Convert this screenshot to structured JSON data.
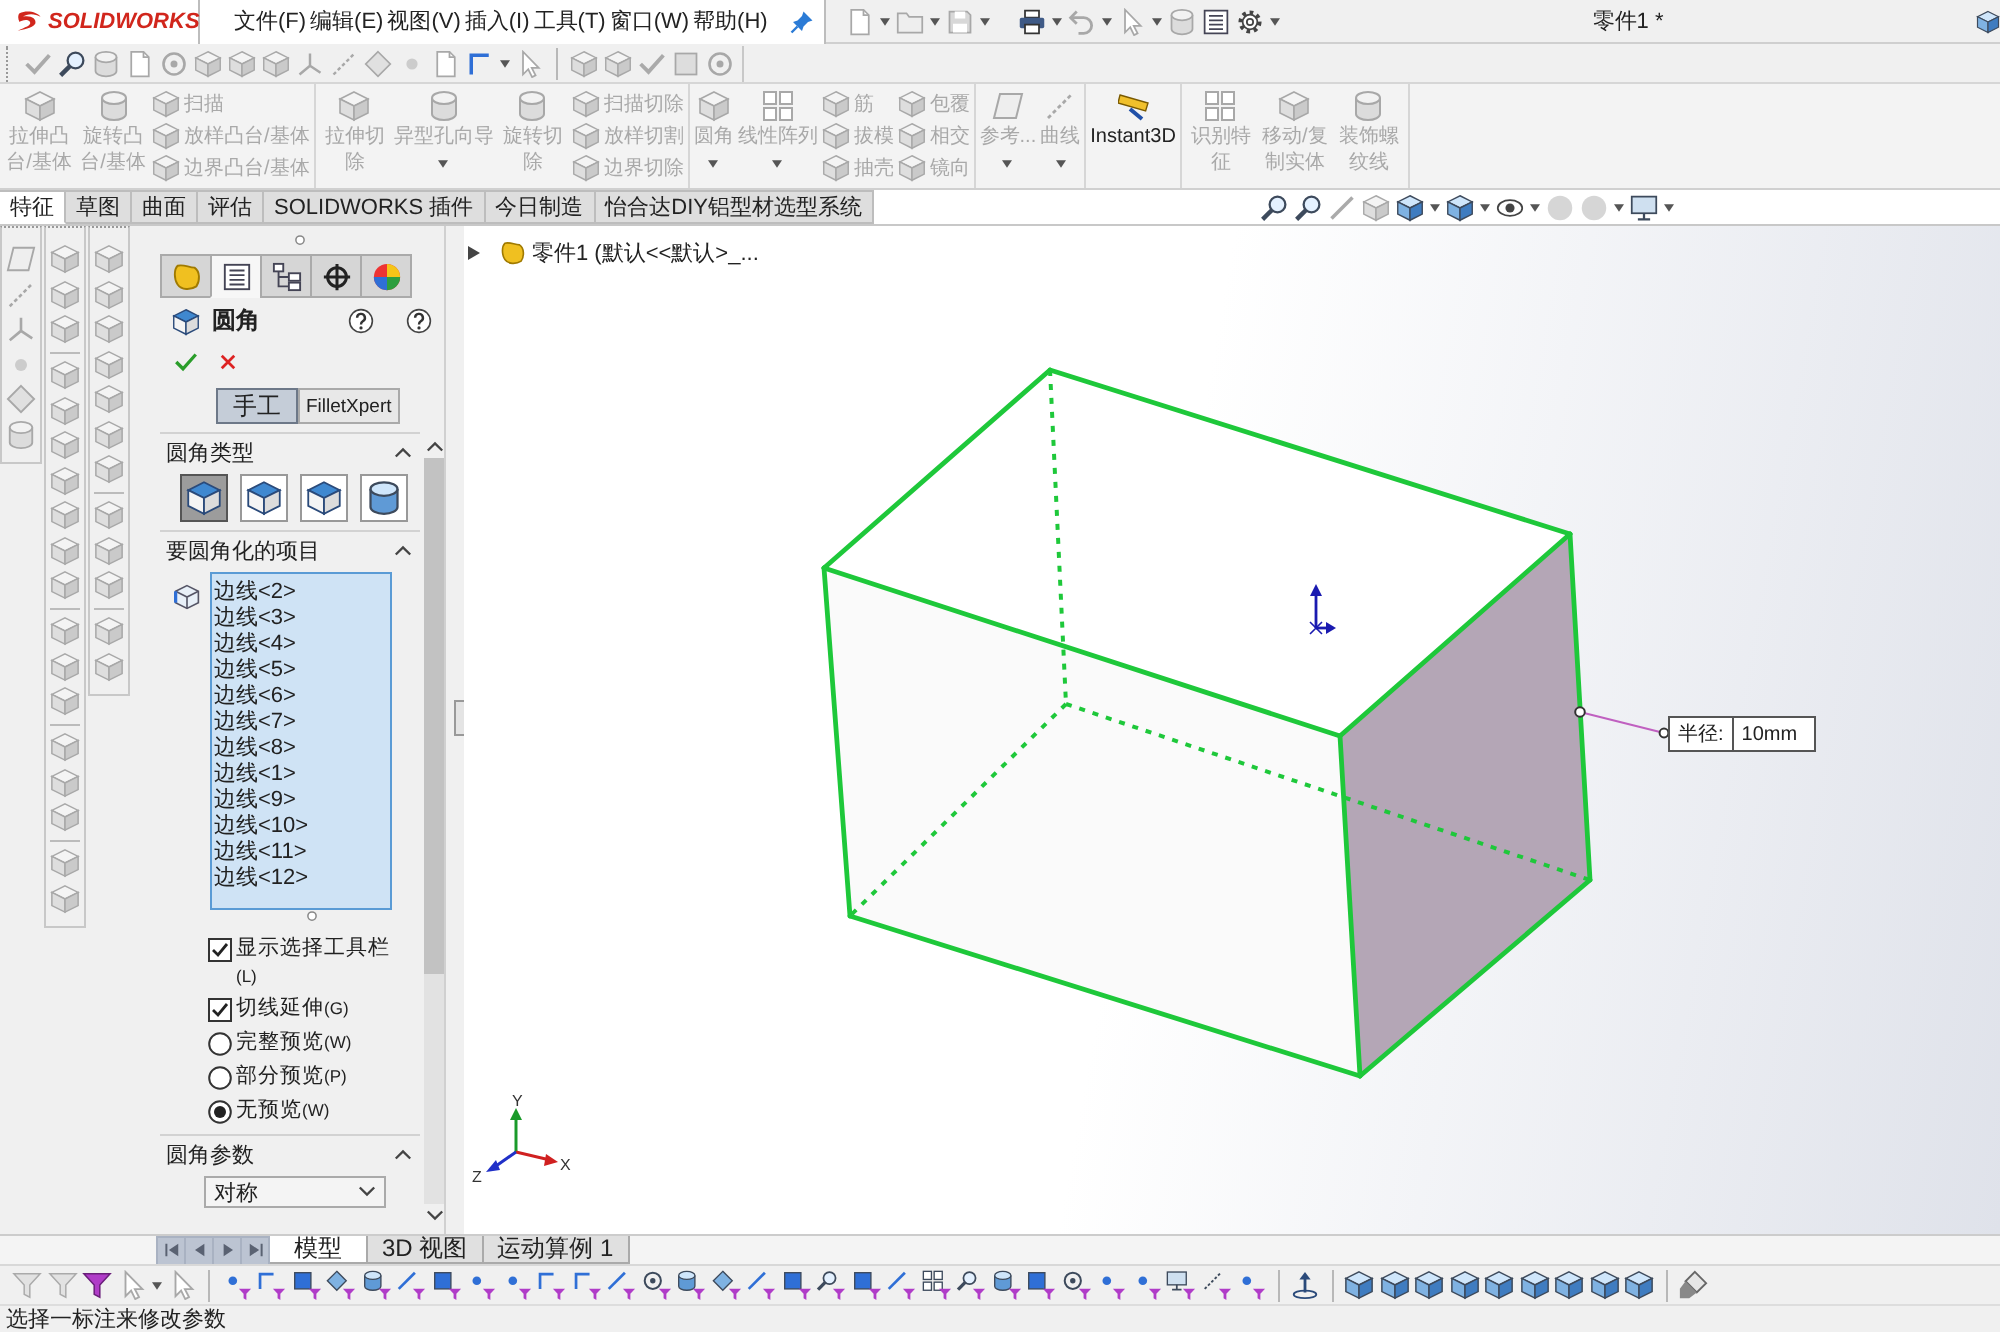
{
  "title_bar": {
    "logo": "SOLIDWORKS",
    "menu": [
      "文件(F)",
      "编辑(E)",
      "视图(V)",
      "插入(I)",
      "工具(T)",
      "窗口(W)",
      "帮助(H)"
    ],
    "document_title": "零件1 *"
  },
  "ribbon": {
    "groups": [
      {
        "items": [
          {
            "kind": "large_wrap",
            "label": "拉伸凸台/基体",
            "disabled": true,
            "dropdown": false
          },
          {
            "kind": "large_wrap",
            "label": "旋转凸台/基体",
            "disabled": true,
            "dropdown": false
          },
          {
            "kind": "stack",
            "buttons": [
              {
                "label": "扫描",
                "disabled": true
              },
              {
                "label": "放样凸台/基体",
                "disabled": true
              },
              {
                "label": "边界凸台/基体",
                "disabled": true
              }
            ]
          }
        ]
      },
      {
        "items": [
          {
            "kind": "large_wrap",
            "label": "拉伸切除",
            "disabled": true,
            "dropdown": false
          },
          {
            "kind": "large",
            "label": "异型孔向导",
            "disabled": true,
            "dropdown": true
          },
          {
            "kind": "large_wrap",
            "label": "旋转切除",
            "disabled": true,
            "dropdown": false
          },
          {
            "kind": "stack",
            "buttons": [
              {
                "label": "扫描切除",
                "disabled": true
              },
              {
                "label": "放样切割",
                "disabled": true
              },
              {
                "label": "边界切除",
                "disabled": true
              }
            ]
          }
        ]
      },
      {
        "items": [
          {
            "kind": "large",
            "label": "圆角",
            "disabled": true,
            "dropdown": true
          },
          {
            "kind": "large",
            "label": "线性阵列",
            "disabled": true,
            "dropdown": true
          },
          {
            "kind": "stack",
            "buttons": [
              {
                "label": "筋",
                "disabled": true
              },
              {
                "label": "拔模",
                "disabled": true
              },
              {
                "label": "抽壳",
                "disabled": true
              }
            ]
          },
          {
            "kind": "stack",
            "buttons": [
              {
                "label": "包覆",
                "disabled": true
              },
              {
                "label": "相交",
                "disabled": true
              },
              {
                "label": "镜向",
                "disabled": true
              }
            ]
          }
        ]
      },
      {
        "items": [
          {
            "kind": "large",
            "label": "参考...",
            "disabled": true,
            "dropdown": true
          },
          {
            "kind": "large",
            "label": "曲线",
            "disabled": true,
            "dropdown": true
          }
        ]
      },
      {
        "items": [
          {
            "kind": "large",
            "label": "Instant3D",
            "disabled": false,
            "dropdown": false
          }
        ]
      },
      {
        "items": [
          {
            "kind": "large_wrap",
            "label": "识别特征",
            "disabled": true,
            "dropdown": false
          },
          {
            "kind": "large_wrap",
            "label": "移动/复制实体",
            "disabled": true,
            "dropdown": false
          },
          {
            "kind": "large_wrap",
            "label": "装饰螺纹线",
            "disabled": true,
            "dropdown": false
          }
        ]
      }
    ]
  },
  "command_tabs": [
    {
      "label": "特征",
      "selected": true
    },
    {
      "label": "草图",
      "selected": false
    },
    {
      "label": "曲面",
      "selected": false
    },
    {
      "label": "评估",
      "selected": false
    },
    {
      "label": "SOLIDWORKS 插件",
      "selected": false
    },
    {
      "label": "今日制造",
      "selected": false
    },
    {
      "label": "怡合达DIY铝型材选型系统",
      "selected": false
    }
  ],
  "property_manager": {
    "tabs": [
      {
        "selected": false
      },
      {
        "selected": true
      },
      {
        "selected": false
      },
      {
        "selected": false
      },
      {
        "selected": false
      }
    ],
    "title": "圆角",
    "modes": [
      {
        "label": "手工",
        "selected": true
      },
      {
        "label": "FilletXpert",
        "selected": false
      }
    ],
    "sections": [
      {
        "kind": "fillet_type",
        "title": "圆角类型",
        "expanded": true,
        "options": [
          {
            "selected": true
          },
          {
            "selected": false
          },
          {
            "selected": false
          },
          {
            "selected": false
          }
        ]
      },
      {
        "kind": "items",
        "title": "要圆角化的项目",
        "expanded": true,
        "edges": [
          "边线<2>",
          "边线<3>",
          "边线<4>",
          "边线<5>",
          "边线<6>",
          "边线<7>",
          "边线<8>",
          "边线<1>",
          "边线<9>",
          "边线<10>",
          "边线<11>",
          "边线<12>"
        ],
        "options": [
          {
            "kind": "checkbox",
            "label": "显示选择工具栏",
            "shortcut": "(L)",
            "checked": true
          },
          {
            "kind": "checkbox",
            "label": "切线延伸",
            "shortcut": "(G)",
            "checked": true
          },
          {
            "kind": "radio",
            "label": "完整预览",
            "shortcut": "(W)",
            "selected": false
          },
          {
            "kind": "radio",
            "label": "部分预览",
            "shortcut": "(P)",
            "selected": false
          },
          {
            "kind": "radio",
            "label": "无预览",
            "shortcut": "(W)",
            "selected": true
          }
        ]
      },
      {
        "kind": "parameters",
        "title": "圆角参数",
        "expanded": true,
        "dropdown": {
          "value": "对称"
        }
      }
    ]
  },
  "graphics": {
    "tree_root": "零件1 (默认<<默认>_...",
    "callout": {
      "label": "半径:",
      "value": "10mm"
    },
    "triad": [
      "Y",
      "X",
      "Z"
    ]
  },
  "bottom_tabs": [
    {
      "label": "模型",
      "selected": true
    },
    {
      "label": "3D 视图",
      "selected": false
    },
    {
      "label": "运动算例 1",
      "selected": false
    }
  ],
  "status_bar": {
    "message": "选择一标注来修改参数"
  }
}
